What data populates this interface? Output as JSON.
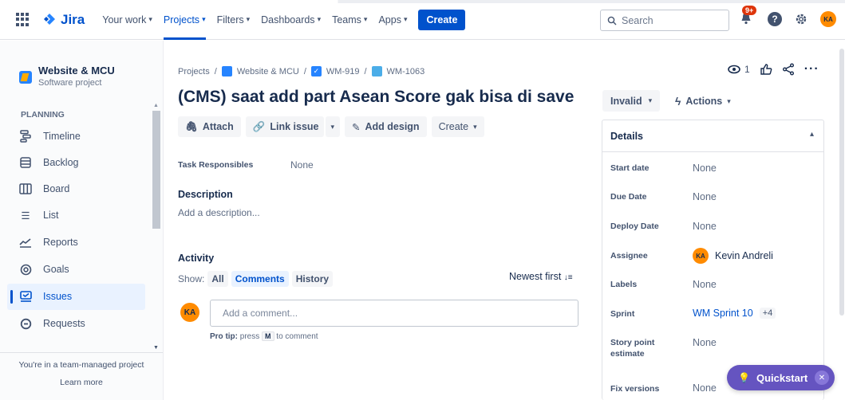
{
  "topnav": {
    "logo": "Jira",
    "items": [
      "Your work",
      "Projects",
      "Filters",
      "Dashboards",
      "Teams",
      "Apps"
    ],
    "create_label": "Create",
    "search_placeholder": "Search",
    "notif_badge": "9+",
    "avatar_initials": "KA",
    "accent": "#0052cc"
  },
  "sidebar": {
    "project_name": "Website & MCU",
    "project_type": "Software project",
    "section": "PLANNING",
    "items": [
      "Timeline",
      "Backlog",
      "Board",
      "List",
      "Reports",
      "Goals",
      "Issues",
      "Requests"
    ],
    "active_item": "Issues",
    "footer_text": "You're in a team-managed project",
    "learn_more": "Learn more"
  },
  "breadcrumb": [
    "Projects",
    "Website & MCU",
    "WM-919",
    "WM-1063"
  ],
  "issue": {
    "title": "(CMS) saat add part Asean Score gak bisa di save",
    "buttons": {
      "attach": "Attach",
      "link": "Link issue",
      "design": "Add design",
      "create": "Create"
    },
    "task_resp_label": "Task Responsibles",
    "task_resp_value": "None",
    "description_label": "Description",
    "description_placeholder": "Add a description...",
    "activity_label": "Activity",
    "show_label": "Show:",
    "filters": [
      "All",
      "Comments",
      "History"
    ],
    "selected_filter": "Comments",
    "sort_label": "Newest first",
    "comment_avatar": "KA",
    "comment_placeholder": "Add a comment...",
    "protip_prefix": "Pro tip:",
    "protip_text": "press",
    "protip_key": "M",
    "protip_suffix": "to comment"
  },
  "right": {
    "watch_count": "1",
    "status": "Invalid",
    "actions": "Actions",
    "details_title": "Details",
    "fields": {
      "start_date": {
        "label": "Start date",
        "value": "None"
      },
      "due_date": {
        "label": "Due Date",
        "value": "None"
      },
      "deploy_date": {
        "label": "Deploy Date",
        "value": "None"
      },
      "assignee": {
        "label": "Assignee",
        "value": "Kevin Andreli",
        "initials": "KA"
      },
      "labels": {
        "label": "Labels",
        "value": "None"
      },
      "sprint": {
        "label": "Sprint",
        "value": "WM Sprint 10",
        "extra": "+4"
      },
      "story_points": {
        "label": "Story point estimate",
        "value": "None"
      },
      "fix_versions": {
        "label": "Fix versions",
        "value": "None"
      }
    }
  },
  "quickstart": {
    "label": "Quickstart"
  }
}
